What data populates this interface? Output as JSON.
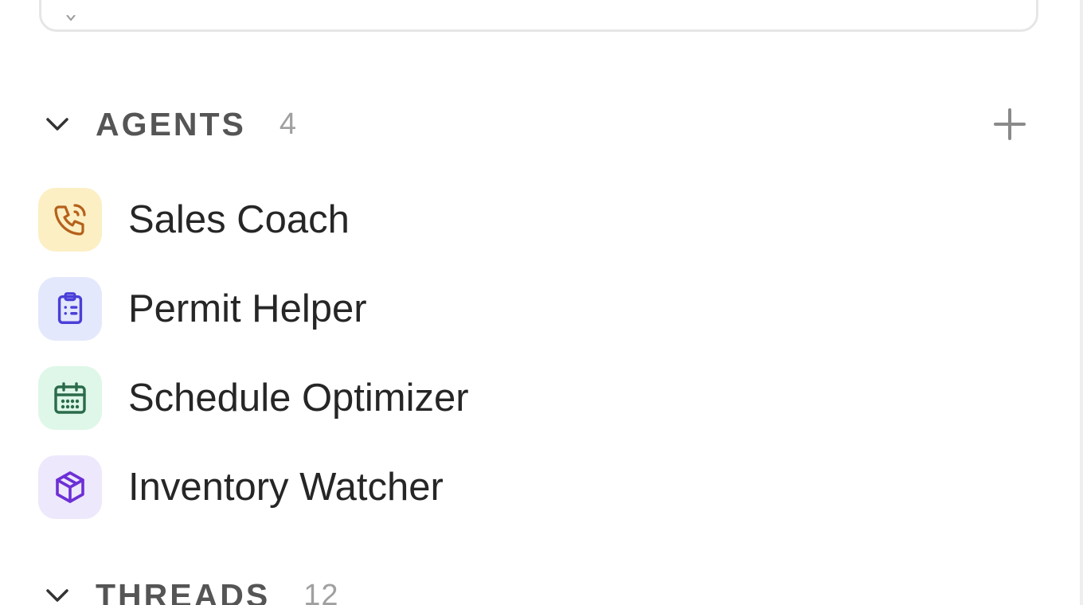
{
  "agents_section": {
    "title": "AGENTS",
    "count": "4",
    "items": [
      {
        "label": "Sales Coach",
        "icon": "phone-icon",
        "bg": "#fcefc4",
        "fg": "#b5611b"
      },
      {
        "label": "Permit Helper",
        "icon": "clipboard-list-icon",
        "bg": "#e4e8fc",
        "fg": "#4a3fd8"
      },
      {
        "label": "Schedule Optimizer",
        "icon": "calendar-icon",
        "bg": "#def7e8",
        "fg": "#2b6b4b"
      },
      {
        "label": "Inventory Watcher",
        "icon": "package-icon",
        "bg": "#ede8fc",
        "fg": "#6d2fd6"
      }
    ]
  },
  "threads_section": {
    "title": "THREADS",
    "count": "12"
  }
}
